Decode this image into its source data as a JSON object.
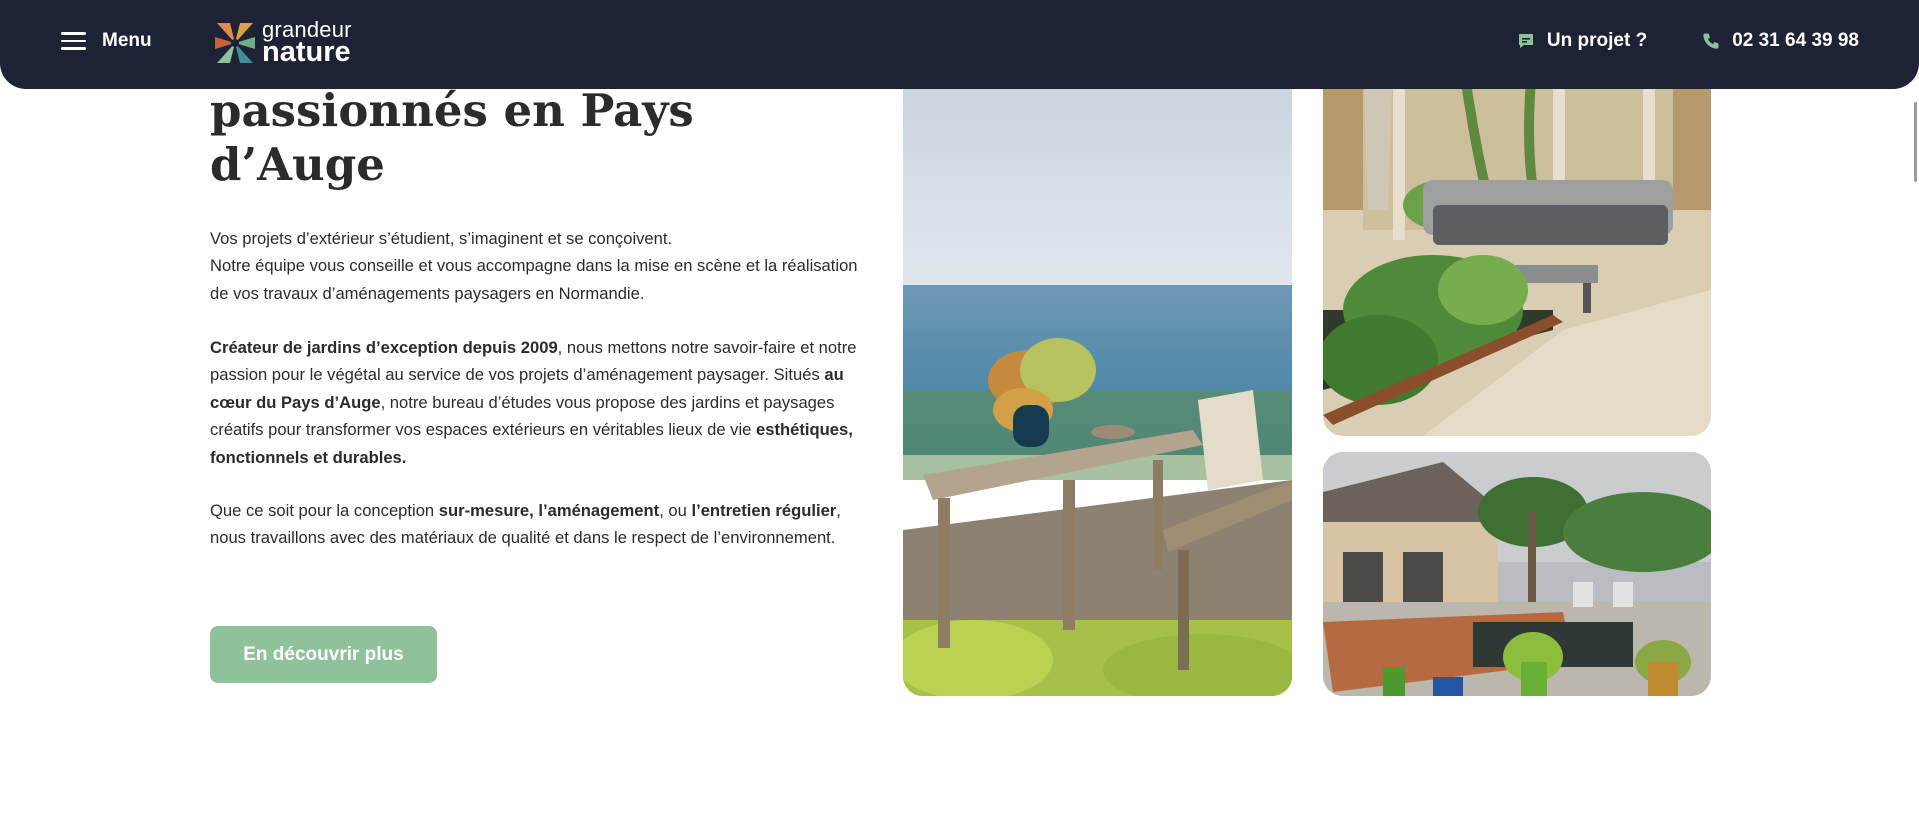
{
  "header": {
    "menu_label": "Menu",
    "logo_line1": "grandeur",
    "logo_line2": "nature",
    "project_label": "Un projet ?",
    "phone": "02 31 64 39 98"
  },
  "intro": {
    "title_line1": "passionnés en Pays",
    "title_line2": "d’Auge",
    "p1_line1": "Vos projets d’extérieur s’étudient, s’imaginent et se conçoivent.",
    "p1_line2": "Notre équipe vous conseille et vous accompagne dans la mise en scène et la réalisation de vos travaux d’aménagements paysagers en Normandie.",
    "p2_b1": "Créateur de jardins d’exception depuis 2009",
    "p2_t1": ", nous mettons notre savoir-faire et notre passion pour le végétal au service de vos projets d’aménagement paysager. Situés ",
    "p2_b2": "au cœur du Pays d’Auge",
    "p2_t2": ", notre bureau d’études vous propose des jardins et paysages créatifs pour transformer vos espaces extérieurs en véritables lieux de vie ",
    "p2_b3": "esthétiques, fonctionnels et durables.",
    "p3_t1": "Que ce soit pour la conception ",
    "p3_b1": "sur-mesure, l’aménagement",
    "p3_t2": ", ou ",
    "p3_b2": "l’entretien régulier",
    "p3_t3": ", nous travaillons avec des matériaux de qualité et dans le respect de l’environnement.",
    "cta_label": "En découvrir plus"
  },
  "colors": {
    "header_bg": "#1e2235",
    "accent_green": "#8fc29b",
    "text": "#2b2b2b"
  },
  "icons": {
    "menu": "hamburger-icon",
    "project": "chat-bubble-icon",
    "phone": "phone-icon"
  }
}
